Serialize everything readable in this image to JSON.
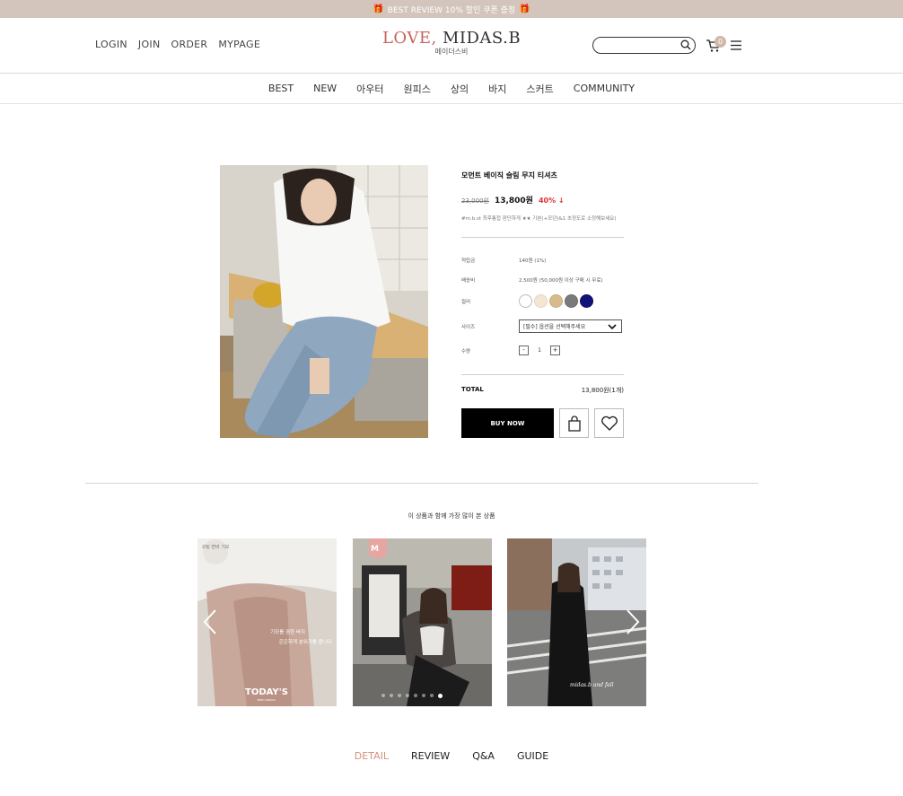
{
  "banner": {
    "text": "BEST REVIEW 10% 할인 쿠폰 증정"
  },
  "header": {
    "util_links": [
      "LOGIN",
      "JOIN",
      "ORDER",
      "MYPAGE"
    ],
    "logo_love": "LOVE,",
    "logo_brand": "MIDAS.B",
    "logo_sub": "메이더스비",
    "search_placeholder": "",
    "cart_count": "0"
  },
  "nav": {
    "items": [
      "BEST",
      "NEW",
      "아우터",
      "원피스",
      "상의",
      "바지",
      "스커트",
      "COMMUNITY"
    ]
  },
  "product": {
    "name": "모먼트 베이직 슬림 무지 티셔츠",
    "original_price": "23,000원",
    "sale_price": "13,800원",
    "discount": "40%",
    "discount_arrow": "↓",
    "description": "#m.b.st 최후통첩 판단하게 ★★ 기본(+모던)&1 초정도로 소정해보세요)",
    "points_label": "적립금",
    "points_value": "140원 (1%)",
    "shipping_label": "배송비",
    "shipping_value": "2,500원 (50,000원 이상 구매 시 무료)",
    "color_label": "컬러",
    "colors": [
      "#ffffff",
      "#f4e6d4",
      "#d7bb8c",
      "#7a7a7a",
      "#12127a"
    ],
    "size_label": "사이즈",
    "size_select": "[필수] 옵션을 선택해주세요",
    "qty_label": "수량",
    "qty_minus": "-",
    "qty_value": "1",
    "qty_plus": "+",
    "total_label": "TOTAL",
    "total_value": "13,800원(1개)",
    "buy_label": "BUY NOW"
  },
  "related": {
    "title": "이 상품과 함께 가장 많이 본 상품",
    "card1_badge": "코팅 면바 기모",
    "card1_caption1": "기모를 겸한 바지",
    "card1_caption2": "은은하게 분위기를 줍니다",
    "card1_footer": "TODAY'S",
    "card1_footer_sub": "NEW ARRIVAL",
    "card2_badge": "M",
    "card3_text": "midas.b and fall",
    "dots": 8,
    "active_dot": 7
  },
  "tabs": [
    "DETAIL",
    "REVIEW",
    "Q&A",
    "GUIDE"
  ]
}
